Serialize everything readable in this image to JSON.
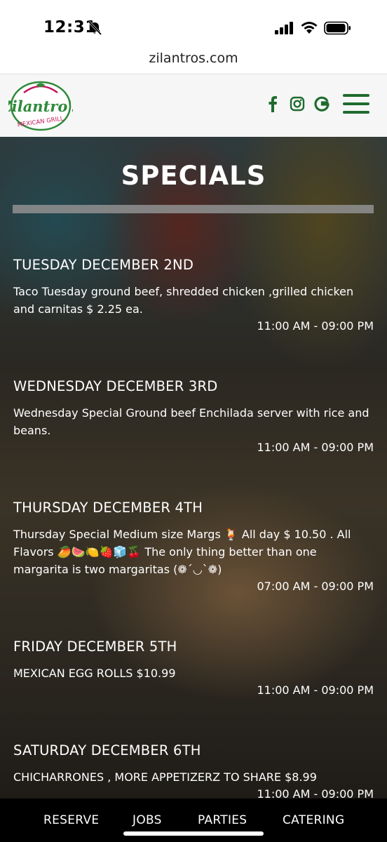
{
  "status_bar": {
    "time": "12:31"
  },
  "browser": {
    "url": "zilantros.com"
  },
  "header": {
    "logo_text": "Zilantro's",
    "logo_subtext": "MEXICAN GRILL",
    "social_icons": [
      "facebook-icon",
      "instagram-icon",
      "google-icon"
    ],
    "brand_color": "#1f6b2e"
  },
  "page": {
    "title": "SPECIALS"
  },
  "specials": [
    {
      "day": "TUESDAY DECEMBER 2ND",
      "description": "Taco Tuesday ground beef, shredded chicken ,grilled chicken and carnitas $ 2.25 ea.",
      "hours": "11:00 AM - 09:00 PM"
    },
    {
      "day": "WEDNESDAY DECEMBER 3RD",
      "description": "Wednesday Special Ground beef Enchilada server with rice and beans.",
      "hours": "11:00 AM - 09:00 PM"
    },
    {
      "day": "THURSDAY DECEMBER 4TH",
      "description": "Thursday Special Medium size Margs 🍹 All day $ 10.50 . All Flavors 🥭🍉🍋🍓🧊🍒 The only thing better than one margarita is two margaritas (❁´◡`❁)",
      "hours": "07:00 AM - 09:00 PM"
    },
    {
      "day": "FRIDAY DECEMBER 5TH",
      "description": "MEXICAN EGG ROLLS $10.99",
      "hours": "11:00 AM - 09:00 PM"
    },
    {
      "day": "SATURDAY DECEMBER 6TH",
      "description": "CHICHARRONES , MORE APPETIZERZ TO SHARE $8.99",
      "hours": "11:00 AM - 09:00 PM"
    }
  ],
  "bottom_nav": [
    "RESERVE",
    "JOBS",
    "PARTIES",
    "CATERING"
  ]
}
